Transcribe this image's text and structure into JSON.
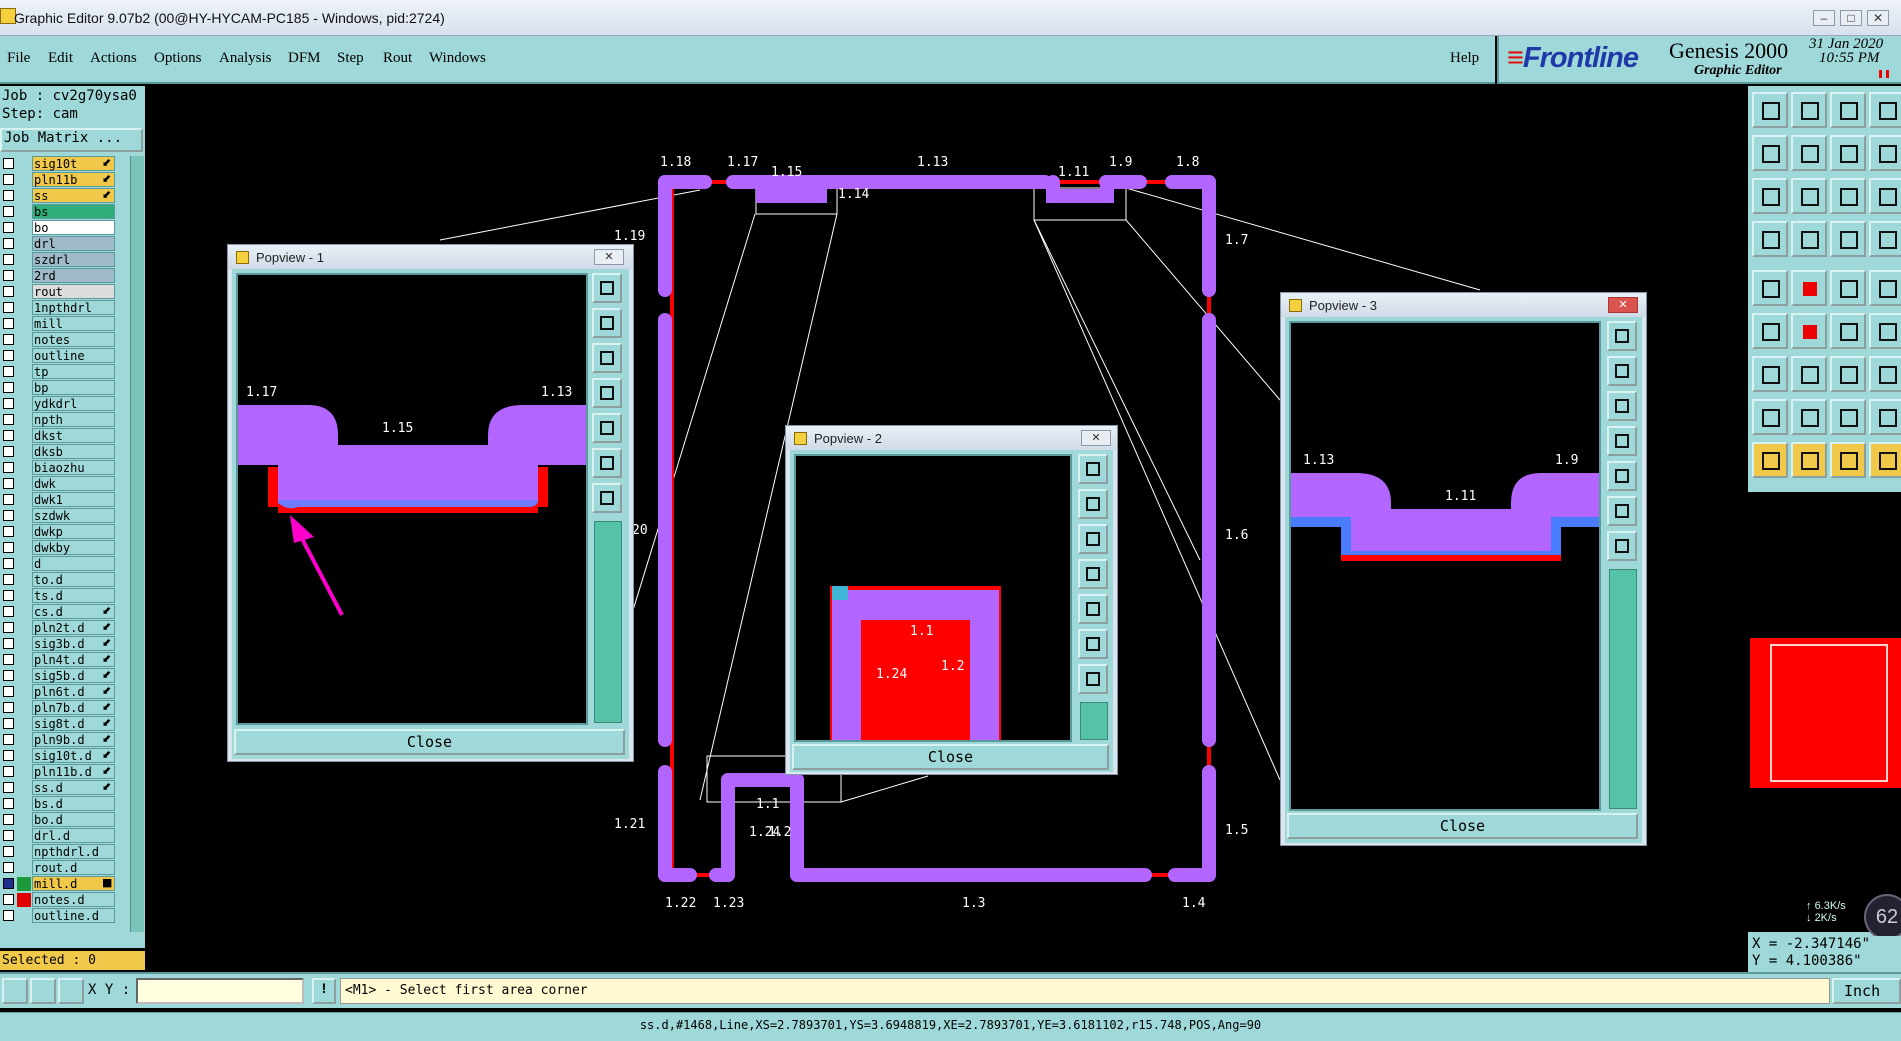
{
  "window": {
    "title": "Graphic Editor 9.07b2 (00@HY-HYCAM-PC185 - Windows, pid:2724)"
  },
  "menu": {
    "items": [
      "File",
      "Edit",
      "Actions",
      "Options",
      "Analysis",
      "DFM",
      "Step",
      "Rout",
      "Windows"
    ],
    "help": "Help"
  },
  "brand": {
    "logo": "Frontline",
    "product": "Genesis 2000",
    "subtitle": "Graphic Editor",
    "date": "31 Jan 2020",
    "time": "10:55 PM"
  },
  "job": {
    "job_label": "Job : cv2g70ysa0",
    "step_label": "Step: cam",
    "matrix_button": "Job Matrix ..."
  },
  "layers": [
    {
      "name": "sig10t",
      "color": "#f0c84a",
      "mark": "⬋"
    },
    {
      "name": "pln11b",
      "color": "#f0c84a",
      "mark": "⬋"
    },
    {
      "name": "ss",
      "color": "#f0c84a",
      "mark": "⬋"
    },
    {
      "name": "bs",
      "color": "#2fae7a",
      "mark": ""
    },
    {
      "name": "bo",
      "color": "#ffffff",
      "mark": ""
    },
    {
      "name": "drl",
      "color": "#9fbac8",
      "mark": ""
    },
    {
      "name": "szdrl",
      "color": "#9fbac8",
      "mark": ""
    },
    {
      "name": "2rd",
      "color": "#9fbac8",
      "mark": ""
    },
    {
      "name": "rout",
      "color": "#dcdcdc",
      "mark": ""
    },
    {
      "name": "1npthdrl",
      "color": "#9ed8d8",
      "mark": ""
    },
    {
      "name": "mill",
      "color": "#9ed8d8",
      "mark": ""
    },
    {
      "name": "notes",
      "color": "#9ed8d8",
      "mark": ""
    },
    {
      "name": "outline",
      "color": "#9ed8d8",
      "mark": ""
    },
    {
      "name": "tp",
      "color": "#9ed8d8",
      "mark": ""
    },
    {
      "name": "bp",
      "color": "#9ed8d8",
      "mark": ""
    },
    {
      "name": "ydkdrl",
      "color": "#9ed8d8",
      "mark": ""
    },
    {
      "name": "npth",
      "color": "#9ed8d8",
      "mark": ""
    },
    {
      "name": "dkst",
      "color": "#9ed8d8",
      "mark": ""
    },
    {
      "name": "dksb",
      "color": "#9ed8d8",
      "mark": ""
    },
    {
      "name": "biaozhu",
      "color": "#9ed8d8",
      "mark": ""
    },
    {
      "name": "dwk",
      "color": "#9ed8d8",
      "mark": ""
    },
    {
      "name": "dwk1",
      "color": "#9ed8d8",
      "mark": ""
    },
    {
      "name": "szdwk",
      "color": "#9ed8d8",
      "mark": ""
    },
    {
      "name": "dwkp",
      "color": "#9ed8d8",
      "mark": ""
    },
    {
      "name": "dwkby",
      "color": "#9ed8d8",
      "mark": ""
    },
    {
      "name": "d",
      "color": "#9ed8d8",
      "mark": ""
    },
    {
      "name": "to.d",
      "color": "#9ed8d8",
      "mark": ""
    },
    {
      "name": "ts.d",
      "color": "#9ed8d8",
      "mark": ""
    },
    {
      "name": "cs.d",
      "color": "#9ed8d8",
      "mark": "⬋"
    },
    {
      "name": "pln2t.d",
      "color": "#9ed8d8",
      "mark": "⬋"
    },
    {
      "name": "sig3b.d",
      "color": "#9ed8d8",
      "mark": "⬋"
    },
    {
      "name": "pln4t.d",
      "color": "#9ed8d8",
      "mark": "⬋"
    },
    {
      "name": "sig5b.d",
      "color": "#9ed8d8",
      "mark": "⬋"
    },
    {
      "name": "pln6t.d",
      "color": "#9ed8d8",
      "mark": "⬋"
    },
    {
      "name": "pln7b.d",
      "color": "#9ed8d8",
      "mark": "⬋"
    },
    {
      "name": "sig8t.d",
      "color": "#9ed8d8",
      "mark": "⬋"
    },
    {
      "name": "pln9b.d",
      "color": "#9ed8d8",
      "mark": "⬋"
    },
    {
      "name": "sig10t.d",
      "color": "#9ed8d8",
      "mark": "⬋"
    },
    {
      "name": "pln11b.d",
      "color": "#9ed8d8",
      "mark": "⬋"
    },
    {
      "name": "ss.d",
      "color": "#9ed8d8",
      "mark": "⬋"
    },
    {
      "name": "bs.d",
      "color": "#9ed8d8",
      "mark": ""
    },
    {
      "name": "bo.d",
      "color": "#9ed8d8",
      "mark": ""
    },
    {
      "name": "drl.d",
      "color": "#9ed8d8",
      "mark": ""
    },
    {
      "name": "npthdrl.d",
      "color": "#9ed8d8",
      "mark": ""
    },
    {
      "name": "rout.d",
      "color": "#9ed8d8",
      "mark": ""
    },
    {
      "name": "mill.d",
      "color": "#f0c84a",
      "mark": "■",
      "swatch": "#1e9a3c",
      "checked": true
    },
    {
      "name": "notes.d",
      "color": "#9ed8d8",
      "mark": "",
      "swatch": "#e00000"
    },
    {
      "name": "outline.d",
      "color": "#9ed8d8",
      "mark": ""
    }
  ],
  "selected": "Selected : 0",
  "labels": {
    "l1_18": "1.18",
    "l1_17": "1.17",
    "l1_15": "1.15",
    "l1_13": "1.13",
    "l1_11": "1.11",
    "l1_9": "1.9",
    "l1_8": "1.8",
    "l1_14": "1.14",
    "l1_19": "1.19",
    "l1_7": "1.7",
    "l1_20": "20",
    "l1_6": "1.6",
    "l1_21": "1.21",
    "l1_5": "1.5",
    "l1_22": "1.22",
    "l1_23": "1.23",
    "l1_3": "1.3",
    "l1_4": "1.4",
    "l1_1": "1.1",
    "l1_24": "1.24",
    "l1_2": "1.2"
  },
  "popview1": {
    "title": "Popview - 1",
    "close": "Close",
    "labels": [
      "1.17",
      "1.15",
      "1.13"
    ]
  },
  "popview2": {
    "title": "Popview - 2",
    "close": "Close",
    "labels": [
      "1.1",
      "1.24",
      "1.2"
    ]
  },
  "popview3": {
    "title": "Popview - 3",
    "close": "Close",
    "labels": [
      "1.13",
      "1.11",
      "1.9"
    ]
  },
  "bottom": {
    "xy_label": "X Y :",
    "xy_value": "",
    "prompt": "<M1> - Select first area corner",
    "unit": "Inch"
  },
  "coords": {
    "x": "X = -2.347146\"",
    "y": "Y = 4.100386\""
  },
  "speed": {
    "up": "6.3K/s",
    "down": "2K/s",
    "badge": "62"
  },
  "status": "ss.d,#1468,Line,XS=2.7893701,YS=3.6948819,XE=2.7893701,YE=3.6181102,r15.748,POS,Ang=90",
  "colors": {
    "copper": "#b266ff",
    "outline": "#ff0000",
    "edge": "#4a7cff",
    "panel": "#9ed8d8",
    "arrow": "#ff00cc"
  }
}
